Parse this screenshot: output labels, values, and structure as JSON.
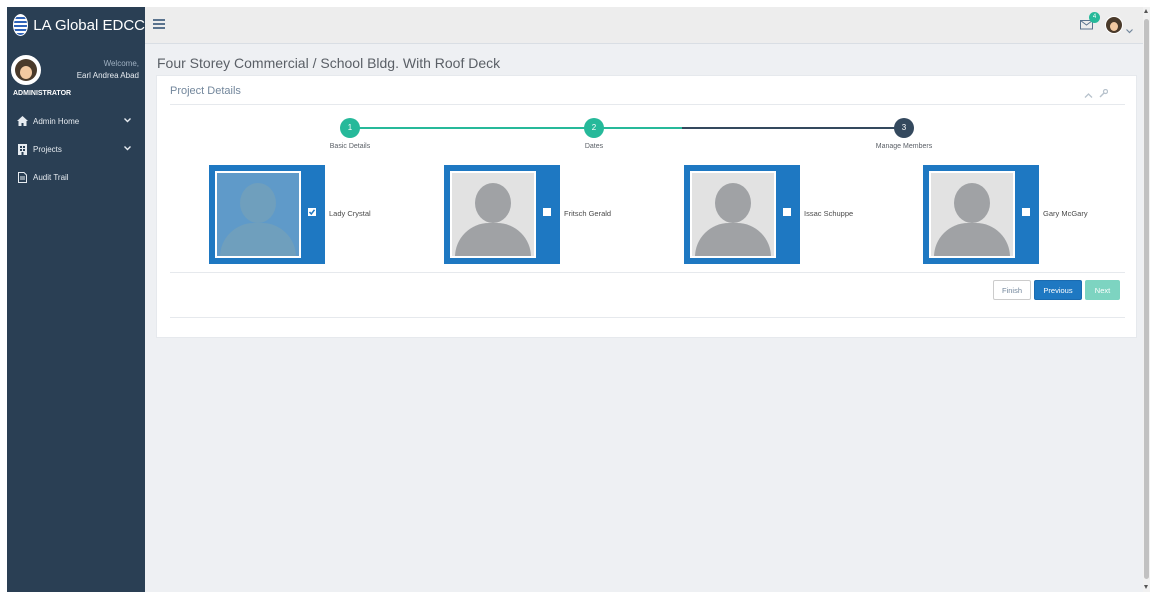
{
  "brand": {
    "name": "LA Global EDCC"
  },
  "profile": {
    "welcome": "Welcome,",
    "name": "Earl Andrea Abad",
    "role": "ADMINISTRATOR"
  },
  "sidebar": {
    "items": [
      {
        "label": "Admin Home",
        "icon": "home-icon",
        "has_chevron": true
      },
      {
        "label": "Projects",
        "icon": "building-icon",
        "has_chevron": true
      },
      {
        "label": "Audit Trail",
        "icon": "document-icon",
        "has_chevron": false
      }
    ]
  },
  "topbar": {
    "notification_count": "4"
  },
  "page": {
    "title": "Four Storey Commercial / School Bldg. With Roof Deck"
  },
  "panel": {
    "title": "Project Details"
  },
  "wizard": {
    "steps": [
      {
        "number": "1",
        "label": "Basic Details",
        "state": "done"
      },
      {
        "number": "2",
        "label": "Dates",
        "state": "done"
      },
      {
        "number": "3",
        "label": "Manage Members",
        "state": "current"
      }
    ],
    "colors": {
      "done": "#26b99a",
      "current": "#34495e"
    }
  },
  "members": [
    {
      "name": "Lady Crystal",
      "selected": true
    },
    {
      "name": "Fritsch Gerald",
      "selected": false
    },
    {
      "name": "Issac Schuppe",
      "selected": false
    },
    {
      "name": "Gary McGary",
      "selected": false
    }
  ],
  "buttons": {
    "finish": "Finish",
    "previous": "Previous",
    "next": "Next"
  }
}
